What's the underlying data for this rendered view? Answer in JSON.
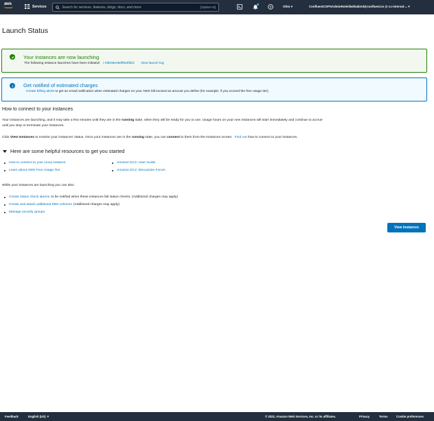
{
  "nav": {
    "logo_text": "aws",
    "services_label": "Services",
    "search_placeholder": "Search for services, features, blogs, docs, and more",
    "search_shortcut": "[Option+S]",
    "region": "Ohio ▾",
    "account": "ConfluentCOPSAdminRole/dwiktakind@confluent.io @ cc-internal-... ▾",
    "icons": [
      "cloudshell-icon",
      "bell-icon",
      "help-icon"
    ],
    "colors": {
      "bar": "#232f3e",
      "accent": "#ff9900"
    }
  },
  "page": {
    "title": "Launch Status"
  },
  "success_alert": {
    "title": "Your instances are now launching",
    "text": "The following instance launches have been initiated:",
    "instance_id": "i-03b06e45df854fd52",
    "launch_log_link": "View launch log",
    "color": "#1d8102"
  },
  "info_alert": {
    "title": "Get notified of estimated charges",
    "link": "Create billing alerts",
    "text": "to get an email notification when estimated charges on your AWS bill exceed an amount you define (for example, if you exceed the free usage tier).",
    "color": "#0073bb"
  },
  "connect": {
    "heading": "How to connect to your instances",
    "p1_a": "Your instances are launching, and it may take a few minutes until they are in the",
    "p1_b": "running",
    "p1_c": "state, when they will be ready for you to use. Usage hours on your new instances will start immediately and continue to accrue",
    "p1_d": "until you stop or terminate your instances.",
    "p2_a": "Click",
    "p2_b": "View Instances",
    "p2_c": "to monitor your instances' status. Once your instances are in the",
    "p2_d": "running",
    "p2_e": "state, you can",
    "p2_f": "connect",
    "p2_g": "to them from the Instances screen.",
    "p2_link": "Find out",
    "p2_h": "how to connect to your instances."
  },
  "resources": {
    "heading": "Here are some helpful resources to get you started",
    "left": [
      "How to connect to your Linux instance",
      "Learn about AWS Free Usage Tier"
    ],
    "right": [
      "Amazon EC2: User Guide",
      "Amazon EC2: Discussion Forum"
    ]
  },
  "while_launching": {
    "heading": "While your instances are launching you can also",
    "items": [
      {
        "link": "Create status check alarms",
        "rest": "to be notified when these instances fail status checks. (Additional charges may apply)"
      },
      {
        "link": "Create and attach additional EBS volumes",
        "rest": "(Additional charges may apply)"
      },
      {
        "link": "Manage security groups",
        "rest": ""
      }
    ]
  },
  "actions": {
    "view_instances": "View Instances"
  },
  "footer": {
    "feedback": "Feedback",
    "language": "English (US) ▼",
    "copyright": "© 2022, Amazon Web Services, Inc. or its affiliates.",
    "privacy": "Privacy",
    "terms": "Terms",
    "cookie": "Cookie preferences"
  }
}
